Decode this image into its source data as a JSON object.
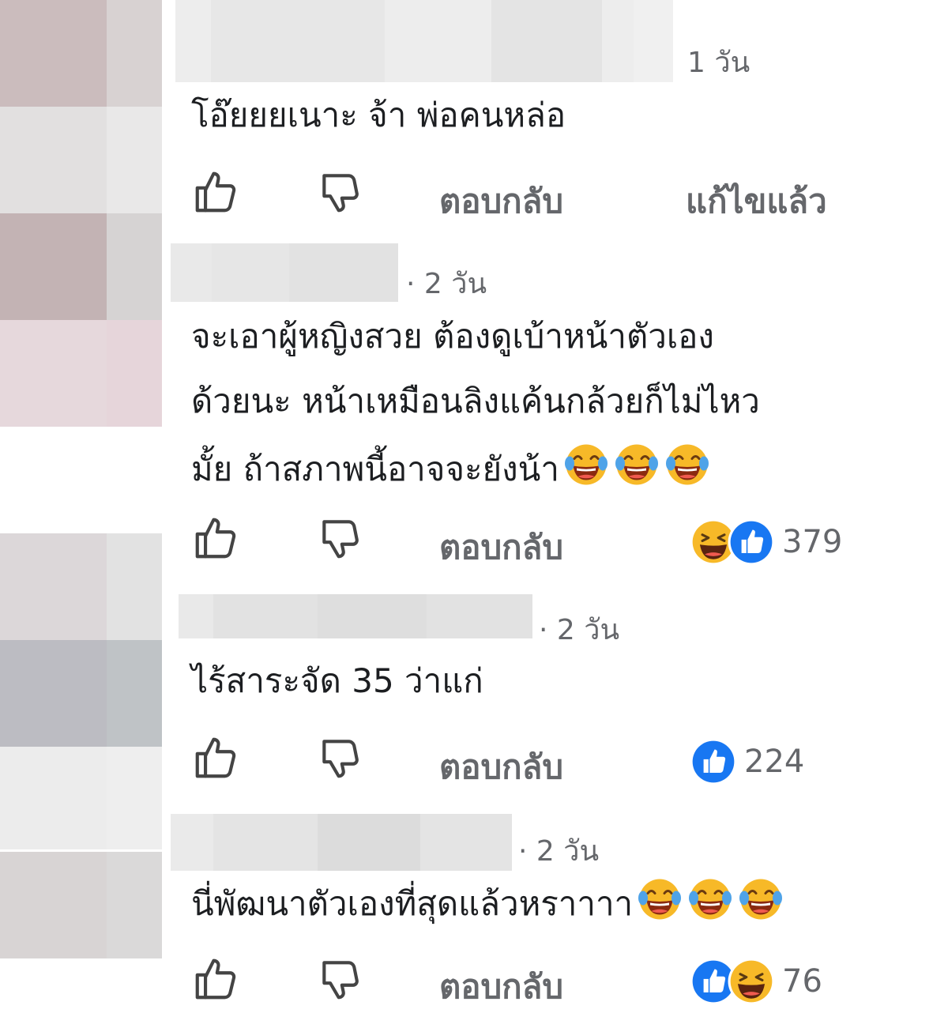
{
  "comments": [
    {
      "time": "1 วัน",
      "text_lines": [
        "โอ๊ยยยเนาะ จ้า พ่อคนหล่อ"
      ],
      "emoji_count": 0,
      "actions": {
        "reply": "ตอบกลับ",
        "edited": "แก้ไขแล้ว"
      }
    },
    {
      "time": "· 2 วัน",
      "text_lines": [
        "จะเอาผู้หญิงสวย ต้องดูเบ้าหน้าตัวเอง",
        "ด้วยนะ หน้าเหมือนลิงแค้นกล้วยก็ไม่ไหว",
        "มั้ย ถ้าสภาพนี้อาจจะยังน้า"
      ],
      "emoji_count": 3,
      "emoji_name": "face-with-tears-of-joy-icon",
      "actions": {
        "reply": "ตอบกลับ"
      },
      "reactions": {
        "types": [
          "haha",
          "like"
        ],
        "count": "379"
      }
    },
    {
      "time": "· 2 วัน",
      "text_lines": [
        "ไร้สาระจัด 35 ว่าแก่"
      ],
      "emoji_count": 0,
      "actions": {
        "reply": "ตอบกลับ"
      },
      "reactions": {
        "types": [
          "like"
        ],
        "count": "224"
      }
    },
    {
      "time": "· 2 วัน",
      "text_lines": [
        "นี่พัฒนาตัวเองที่สุดแล้วหราาาา"
      ],
      "emoji_count": 3,
      "emoji_name": "face-with-tears-of-joy-icon",
      "actions": {
        "reply": "ตอบกลับ"
      },
      "reactions": {
        "types": [
          "like",
          "haha"
        ],
        "count": "76"
      }
    }
  ],
  "colors": {
    "like_blue": "#1877f2",
    "haha_yellow": "#f7b928",
    "muted": "#65676b",
    "text": "#1c1e21"
  }
}
